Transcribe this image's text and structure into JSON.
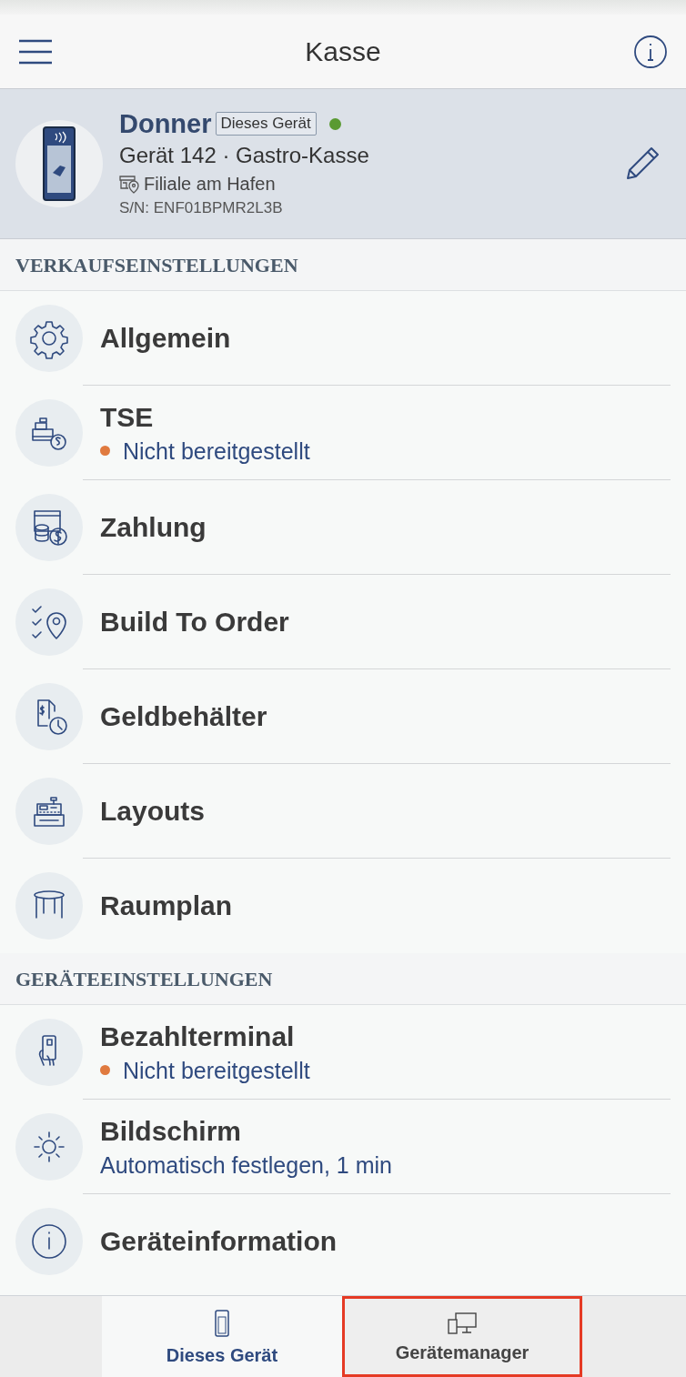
{
  "header": {
    "title": "Kasse"
  },
  "device": {
    "name": "Donner",
    "badge": "Dieses Gerät",
    "online": true,
    "model": "Gerät 142 · Gastro-Kasse",
    "location": "Filiale am Hafen",
    "serial": "S/N: ENF01BPMR2L3B"
  },
  "sections": [
    {
      "title": "VERKAUFSEINSTELLUNGEN",
      "items": [
        {
          "title": "Allgemein"
        },
        {
          "title": "TSE",
          "subtitle": "Nicht bereitgestellt",
          "color": "#e07a3f"
        },
        {
          "title": "Zahlung"
        },
        {
          "title": "Build To Order"
        },
        {
          "title": "Geldbehälter"
        },
        {
          "title": "Layouts"
        },
        {
          "title": "Raumplan"
        }
      ]
    },
    {
      "title": "GERÄTEEINSTELLUNGEN",
      "items": [
        {
          "title": "Bezahlterminal",
          "subtitle": "Nicht bereitgestellt",
          "color": "#e07a3f"
        },
        {
          "title": "Bildschirm",
          "subtitle": "Automatisch festlegen, 1 min"
        },
        {
          "title": "Geräteinformation"
        }
      ]
    }
  ],
  "tabs": [
    {
      "label": "Dieses Gerät",
      "selected": true,
      "highlighted": false
    },
    {
      "label": "Gerätemanager",
      "selected": false,
      "highlighted": true
    }
  ]
}
